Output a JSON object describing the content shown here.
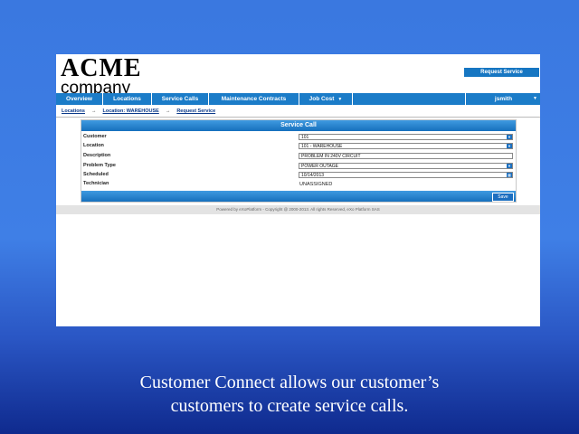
{
  "logo": {
    "line1": "ACME",
    "line2": "company"
  },
  "top_button": "Request Service",
  "nav": {
    "items": [
      "Overview",
      "Locations",
      "Service Calls",
      "Maintenance Contracts",
      "Job Cost"
    ],
    "caret": "▼",
    "user": "jsmith"
  },
  "breadcrumb": {
    "items": [
      "Locations",
      "Location: WAREHOUSE",
      "Request Service"
    ],
    "separator": "→"
  },
  "form": {
    "title": "Service Call",
    "fields": [
      {
        "label": "Customer",
        "value": "101",
        "type": "select"
      },
      {
        "label": "Location",
        "value": "101 - WAREHOUSE",
        "type": "select"
      },
      {
        "label": "Description",
        "value": "PROBLEM IN 240V CIRCUIT",
        "type": "text"
      },
      {
        "label": "Problem Type",
        "value": "POWER OUTAGE",
        "type": "select"
      },
      {
        "label": "Scheduled",
        "value": "10/14/2013",
        "type": "date"
      },
      {
        "label": "Technician",
        "value": "UNASSIGNED",
        "type": "static"
      }
    ],
    "save_label": "Save"
  },
  "footer": "Powered by eXoPlatform - Copyright @ 2000-2013. All rights Reserved, eXo Platform SAS",
  "caption": {
    "line1": "Customer Connect allows our customer’s",
    "line2": "customers to create service calls."
  },
  "colors": {
    "accent": "#1b7cc8",
    "background": "#3f7fe6"
  }
}
